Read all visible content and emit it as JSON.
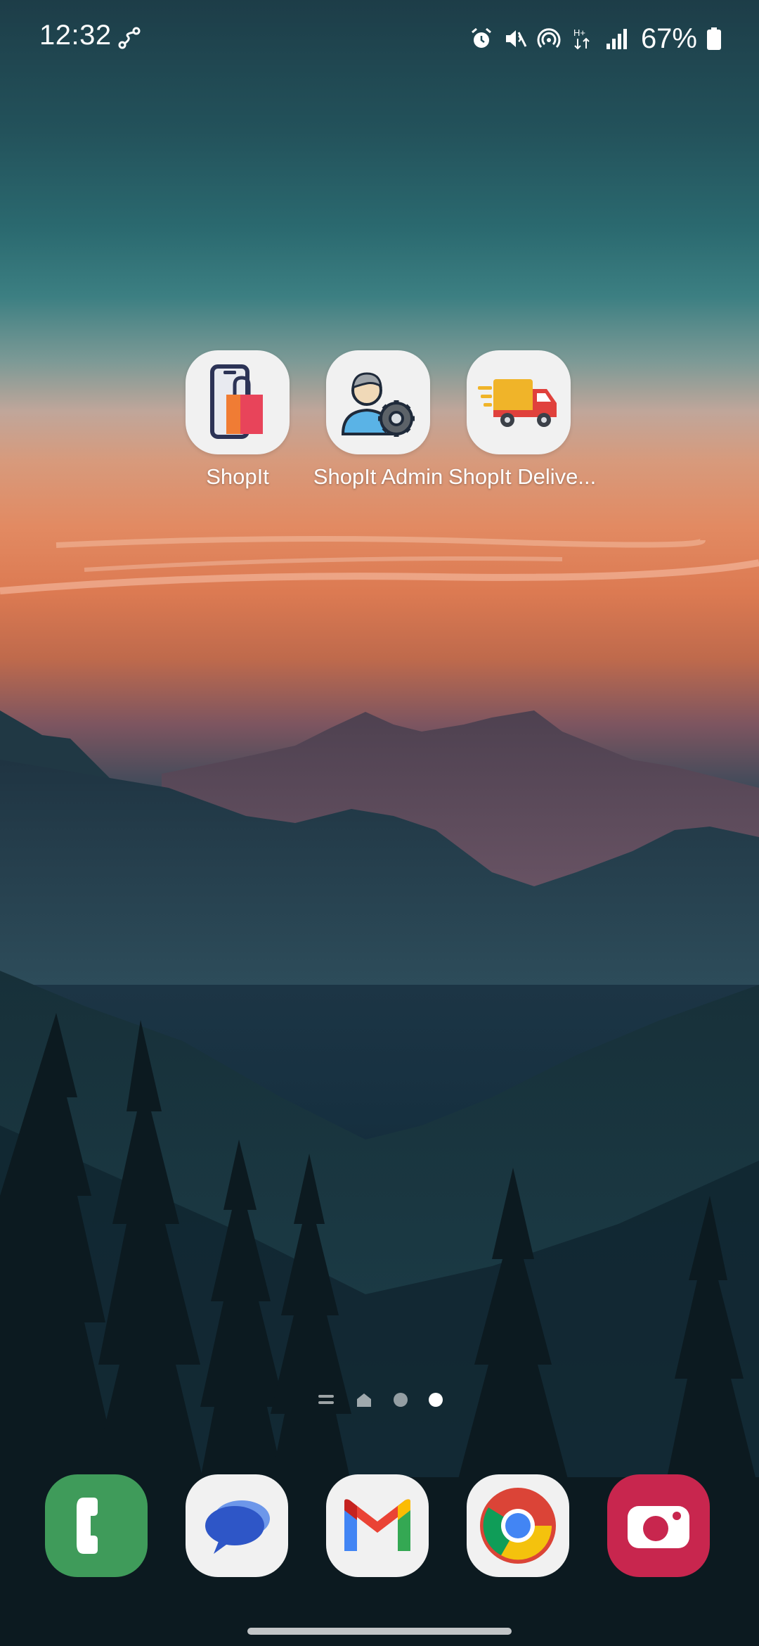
{
  "status_bar": {
    "time": "12:32",
    "battery_percent": "67%",
    "icons": [
      "route-icon",
      "alarm-icon",
      "mute-icon",
      "hotspot-icon",
      "h-plus-data-icon",
      "signal-icon",
      "battery-icon"
    ]
  },
  "home_apps": [
    {
      "label": "ShopIt",
      "icon": "shopping-phone-icon"
    },
    {
      "label": "ShopIt Admin",
      "icon": "admin-gear-icon"
    },
    {
      "label": "ShopIt Delive...",
      "icon": "delivery-truck-icon"
    }
  ],
  "page_indicator": {
    "pages": [
      "menu-page",
      "home-page",
      "page-dot",
      "page-dot"
    ],
    "active_index": 3
  },
  "dock": [
    {
      "name": "Phone",
      "icon": "phone-icon",
      "color": "#3f9b5a"
    },
    {
      "name": "Messages",
      "icon": "messages-icon",
      "color": "#2e5bd0"
    },
    {
      "name": "Gmail",
      "icon": "gmail-icon",
      "color": "#ea4335"
    },
    {
      "name": "Chrome",
      "icon": "chrome-icon",
      "color": "#4285f4"
    },
    {
      "name": "Camera",
      "icon": "camera-icon",
      "color": "#c8264e"
    }
  ]
}
